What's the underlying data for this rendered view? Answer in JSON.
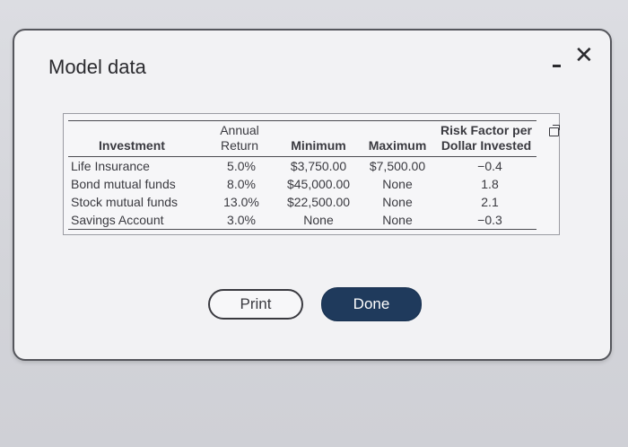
{
  "dialog": {
    "title": "Model data",
    "print_label": "Print",
    "done_label": "Done"
  },
  "table": {
    "headers": {
      "investment": "Investment",
      "annual_line1": "Annual",
      "annual_line2": "Return",
      "minimum": "Minimum",
      "maximum": "Maximum",
      "risk_line1": "Risk Factor per",
      "risk_line2": "Dollar Invested"
    },
    "rows": [
      {
        "investment": "Life Insurance",
        "annual": "5.0%",
        "minimum": "$3,750.00",
        "maximum": "$7,500.00",
        "risk": "−0.4"
      },
      {
        "investment": "Bond mutual funds",
        "annual": "8.0%",
        "minimum": "$45,000.00",
        "maximum": "None",
        "risk": "1.8"
      },
      {
        "investment": "Stock mutual funds",
        "annual": "13.0%",
        "minimum": "$22,500.00",
        "maximum": "None",
        "risk": "2.1"
      },
      {
        "investment": "Savings Account",
        "annual": "3.0%",
        "minimum": "None",
        "maximum": "None",
        "risk": "−0.3"
      }
    ]
  },
  "colors": {
    "done_button": "#1f3a5c",
    "dialog_border": "#55565c"
  }
}
